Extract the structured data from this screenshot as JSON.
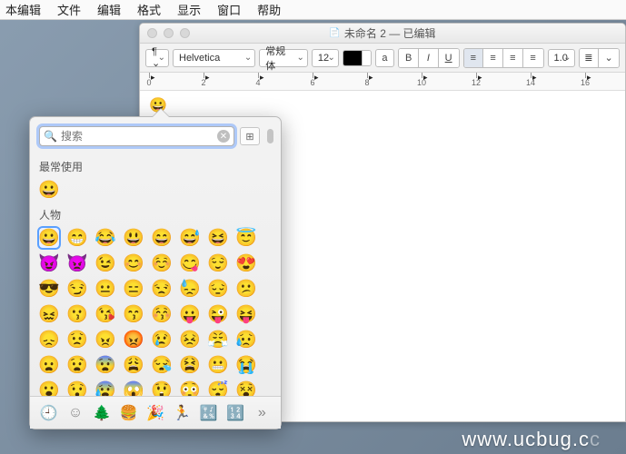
{
  "menubar": [
    "本编辑",
    "文件",
    "编辑",
    "格式",
    "显示",
    "窗口",
    "帮助"
  ],
  "window": {
    "title": "未命名 2 — 已编辑"
  },
  "toolbar": {
    "style_sel": "¶ ⌄",
    "font": "Helvetica",
    "weight": "常规体",
    "size": "12",
    "text_color": "a",
    "bold": "B",
    "italic": "I",
    "underline": "U",
    "spacing": "1.0",
    "list": "≣"
  },
  "ruler": {
    "labels": [
      "0",
      "2",
      "4",
      "6",
      "8",
      "10",
      "12",
      "14",
      "16"
    ]
  },
  "doc": {
    "first_emoji": "😀"
  },
  "emoji": {
    "search_placeholder": "搜索",
    "recent_title": "最常使用",
    "recent": [
      "😀"
    ],
    "people_title": "人物",
    "people": [
      "😀",
      "😁",
      "😂",
      "😃",
      "😄",
      "😅",
      "😆",
      "😇",
      "😈",
      "👿",
      "😉",
      "😊",
      "☺️",
      "😋",
      "😌",
      "😍",
      "😎",
      "😏",
      "😐",
      "😑",
      "😒",
      "😓",
      "😔",
      "😕",
      "😖",
      "😗",
      "😘",
      "😙",
      "😚",
      "😛",
      "😜",
      "😝",
      "😞",
      "😟",
      "😠",
      "😡",
      "😢",
      "😣",
      "😤",
      "😥",
      "😦",
      "😧",
      "😨",
      "😩",
      "😪",
      "😫",
      "😬",
      "😭",
      "😮",
      "😯",
      "😰",
      "😱",
      "😲",
      "😳",
      "😴",
      "😵"
    ],
    "categories": [
      "🕘",
      "☺",
      "🌲",
      "🍔",
      "🎉",
      "🏃",
      "🔣",
      "🔢",
      "»"
    ]
  },
  "watermark": {
    "visible": "www.ucbug.c",
    "dim": "c"
  }
}
